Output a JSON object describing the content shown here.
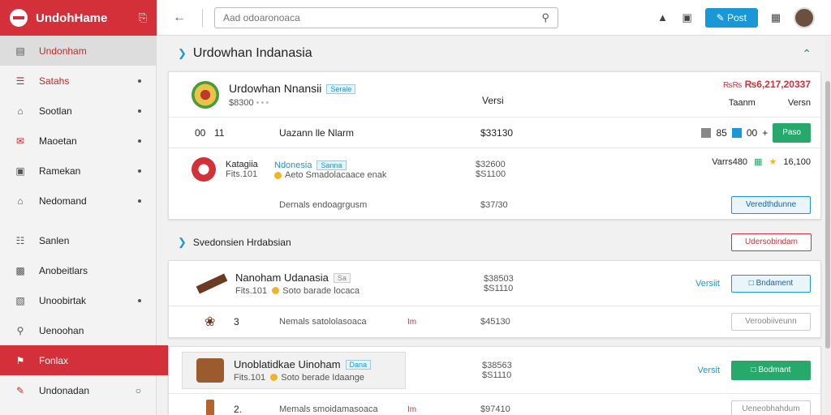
{
  "brand": {
    "title": "UndohHame"
  },
  "search": {
    "placeholder": "Aad odoaronoaca"
  },
  "topbar": {
    "post_label": "Post"
  },
  "sidebar": {
    "items": [
      {
        "label": "Undonham",
        "icon": "grid-icon"
      },
      {
        "label": "Satahs",
        "icon": "list-icon"
      },
      {
        "label": "Sootlan",
        "icon": "home-icon"
      },
      {
        "label": "Maoetan",
        "icon": "mail-icon"
      },
      {
        "label": "Ramekan",
        "icon": "lock-icon"
      },
      {
        "label": "Nedomand",
        "icon": "house-icon"
      },
      {
        "label": "Sanlen",
        "icon": "bars-icon"
      },
      {
        "label": "Anobeitlars",
        "icon": "card-icon"
      },
      {
        "label": "Unoobirtak",
        "icon": "folder-icon"
      },
      {
        "label": "Uenoohan",
        "icon": "pin-icon"
      },
      {
        "label": "Fonlax",
        "icon": "flag-icon"
      },
      {
        "label": "Undonadan",
        "icon": "pencil-icon"
      }
    ]
  },
  "section1": {
    "title": "Urdowhan Indanasia",
    "header": {
      "name": "Urdowhan Nnansii",
      "tag": "Serale",
      "price_code": "₨₨",
      "price_value": "₨6,217,20337",
      "sub_price": "$8300",
      "versi": "Versi",
      "taarn": "Taanm",
      "versn": "Versn"
    },
    "row1": {
      "qty": "00",
      "num": "11",
      "name": "Uazann lle Nlarm",
      "amount": "$33130",
      "count_a": "85",
      "count_b": "00",
      "plus": "+",
      "pass_label": "Paso"
    },
    "row2": {
      "name": "Katagiia",
      "sub": "Fits.101",
      "link": "Ndonesia",
      "tag": "Sanna",
      "desc": "Aeto Smadolacaace enak",
      "amount_a": "$32600",
      "amount_b": "$S1100",
      "versi": "Varrs480",
      "rating": "16,100"
    },
    "row3": {
      "desc": "Dernals endoagrgusm",
      "amount": "$37/30",
      "button": "Veredthdunne"
    }
  },
  "section2": {
    "title": "Svedonsien Hrdabsian",
    "action": "Udersobindam",
    "product1": {
      "name": "Nanoham Udanasia",
      "tag": "Sa",
      "sub": "Fits.101",
      "desc": "Soto barade locaca",
      "amount_a": "$38503",
      "amount_b": "$S1110",
      "versi": "Versiit",
      "button": "Bndament"
    },
    "sub1": {
      "num": "3",
      "desc": "Nemals satololasoaca",
      "mark": "Im",
      "amount": "$45130",
      "button": "Veroobiiveunn"
    },
    "product2": {
      "name": "Unoblatidkae Uinoham",
      "tag": "Dana",
      "sub": "Fits.101",
      "desc": "Soto berade Idaange",
      "amount_a": "$38563",
      "amount_b": "$S1110",
      "versi": "Versit",
      "button": "Bodmant"
    },
    "sub2": {
      "num": "2.",
      "desc": "Memals smoidamasoaca",
      "mark": "Im",
      "amount": "$97410",
      "button": "Ueneobhahdum"
    }
  },
  "colors": {
    "brand": "#d3303a",
    "accent": "#1997d6",
    "success": "#27a96b"
  }
}
